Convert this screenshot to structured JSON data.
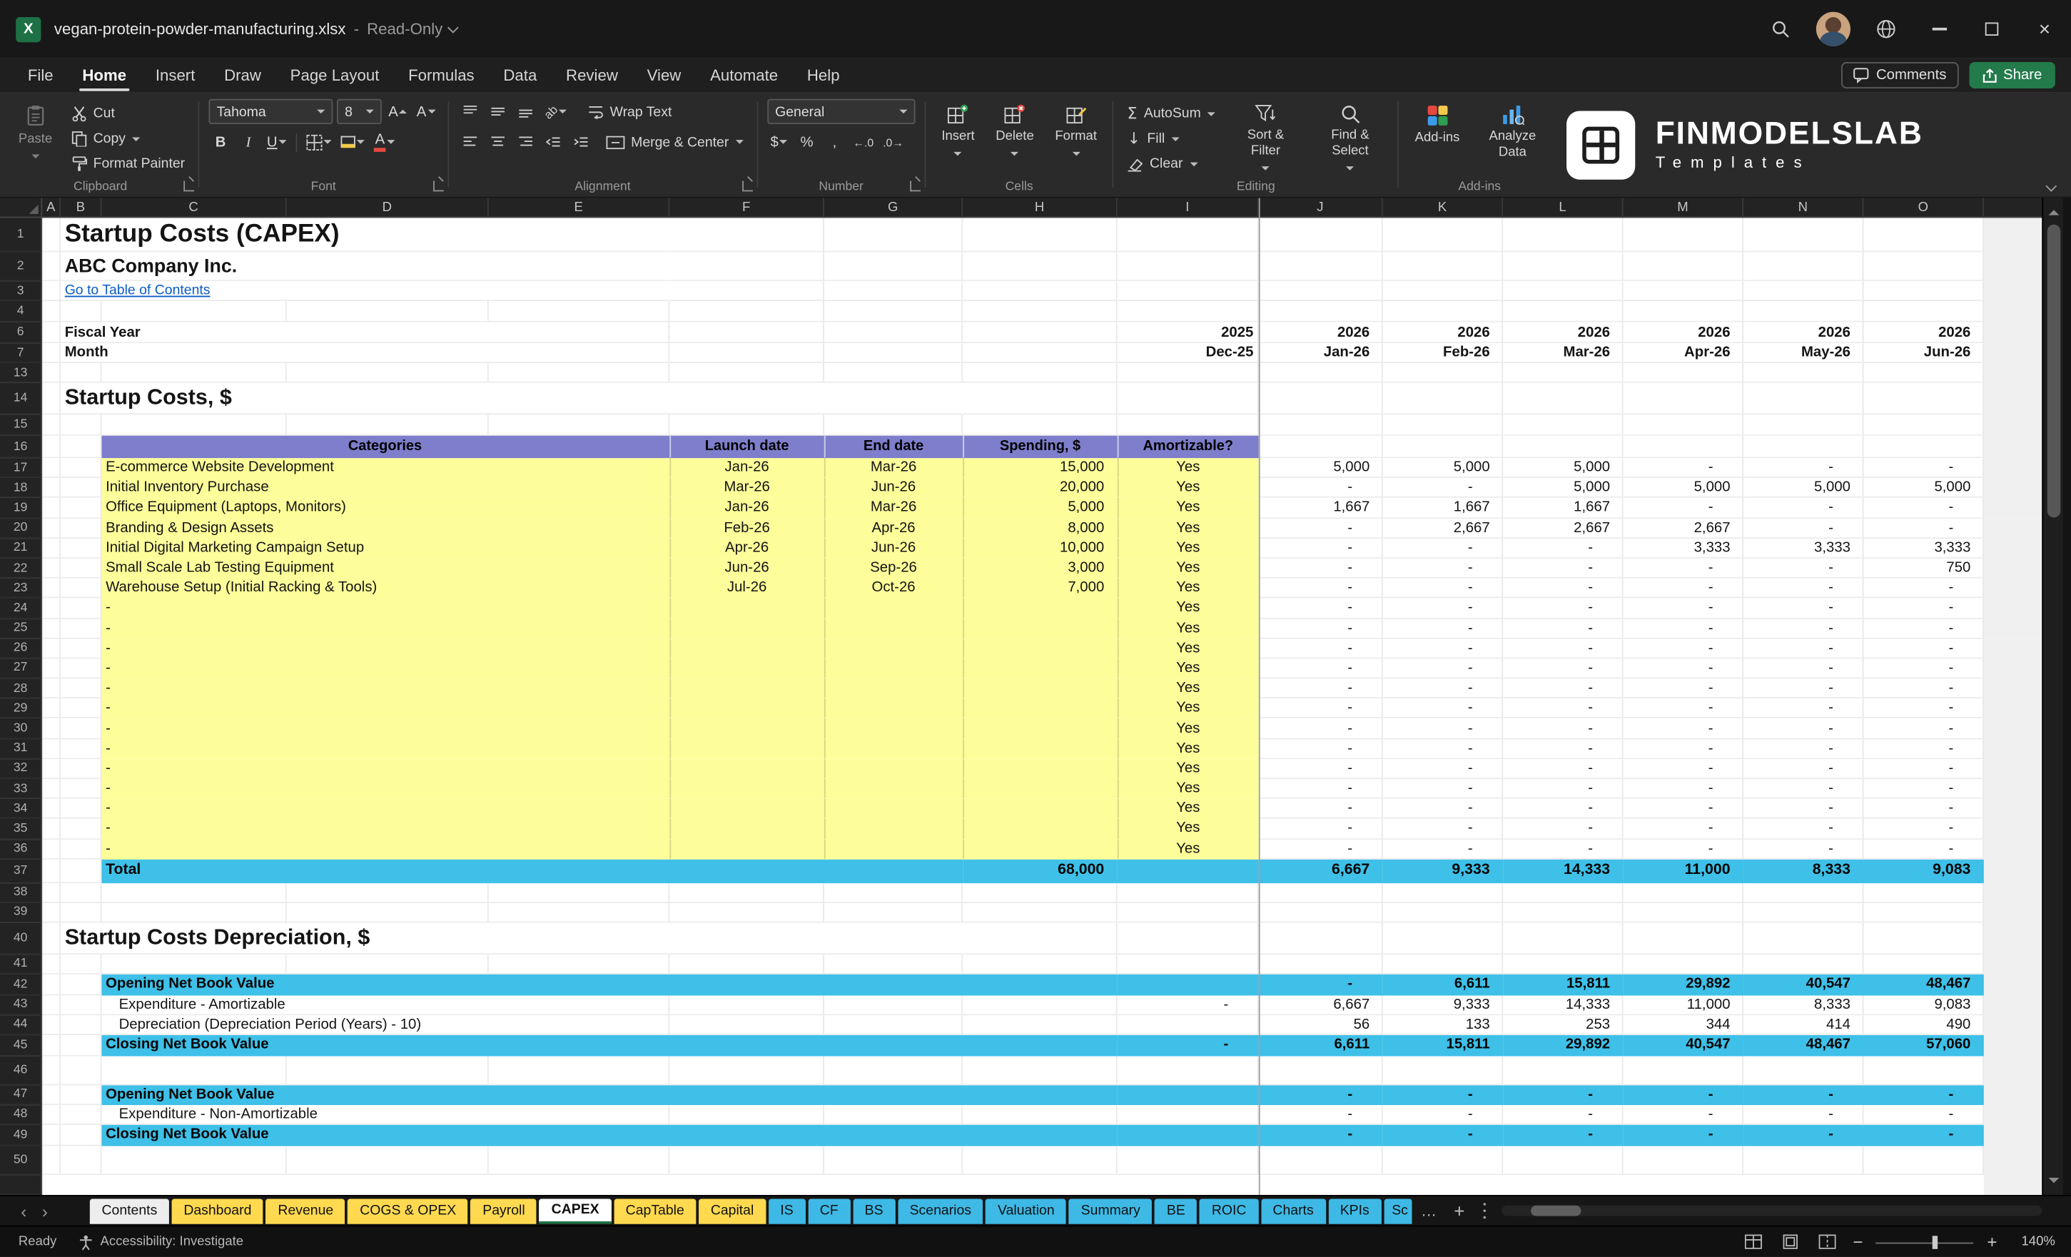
{
  "window": {
    "title": "vegan-protein-powder-manufacturing.xlsx",
    "separator": "-",
    "mode": "Read-Only"
  },
  "menu": {
    "items": [
      "File",
      "Home",
      "Insert",
      "Draw",
      "Page Layout",
      "Formulas",
      "Data",
      "Review",
      "View",
      "Automate",
      "Help"
    ],
    "active": "Home",
    "comments_label": "Comments",
    "share_label": "Share"
  },
  "ribbon": {
    "paste": "Paste",
    "cut": "Cut",
    "copy": "Copy",
    "format_painter": "Format Painter",
    "font_name": "Tahoma",
    "font_size": "8",
    "wrap_text": "Wrap Text",
    "merge_center": "Merge & Center",
    "number_format": "General",
    "insert": "Insert",
    "delete": "Delete",
    "format": "Format",
    "autosum": "AutoSum",
    "fill": "Fill",
    "clear": "Clear",
    "sort_filter": "Sort & Filter",
    "find_select": "Find & Select",
    "addins": "Add-ins",
    "analyze_data": "Analyze Data",
    "groups": {
      "clipboard": "Clipboard",
      "font": "Font",
      "alignment": "Alignment",
      "number": "Number",
      "cells": "Cells",
      "editing": "Editing",
      "addins": "Add-ins"
    }
  },
  "brand": {
    "name": "FINMODELSLAB",
    "subtitle": "Templates"
  },
  "grid_columns": [
    "A",
    "B",
    "C",
    "D",
    "E",
    "F",
    "G",
    "H",
    "I",
    "J",
    "K",
    "L",
    "M",
    "N",
    "O"
  ],
  "sheet": {
    "title": "Startup Costs (CAPEX)",
    "company": "ABC Company Inc.",
    "toc_link": "Go to Table of Contents",
    "row_numbers": [
      1,
      2,
      3,
      4,
      6,
      7,
      13,
      14,
      15,
      16,
      17,
      18,
      19,
      20,
      21,
      22,
      23,
      24,
      25,
      26,
      27,
      28,
      29,
      30,
      31,
      32,
      33,
      34,
      35,
      36,
      37,
      38,
      39,
      40,
      41,
      42,
      43,
      44,
      45,
      46,
      47,
      48,
      49,
      50
    ],
    "fiscal": {
      "label": "Fiscal Year",
      "first": "2025",
      "values": [
        "2026",
        "2026",
        "2026",
        "2026",
        "2026",
        "2026"
      ]
    },
    "month": {
      "label": "Month",
      "first": "Dec-25",
      "values": [
        "Jan-26",
        "Feb-26",
        "Mar-26",
        "Apr-26",
        "May-26",
        "Jun-26"
      ]
    },
    "section1": "Startup Costs, $",
    "table": {
      "headers": {
        "categories": "Categories",
        "launch": "Launch date",
        "end": "End date",
        "spending": "Spending, $",
        "amortizable": "Amortizable?"
      },
      "rows": [
        {
          "category": "E-commerce Website Development",
          "launch": "Jan-26",
          "end": "Mar-26",
          "spending": "15,000",
          "amortizable": "Yes",
          "values": [
            "5,000",
            "5,000",
            "5,000",
            "-",
            "-",
            "-"
          ]
        },
        {
          "category": "Initial Inventory Purchase",
          "launch": "Mar-26",
          "end": "Jun-26",
          "spending": "20,000",
          "amortizable": "Yes",
          "values": [
            "-",
            "-",
            "5,000",
            "5,000",
            "5,000",
            "5,000"
          ]
        },
        {
          "category": "Office Equipment (Laptops, Monitors)",
          "launch": "Jan-26",
          "end": "Mar-26",
          "spending": "5,000",
          "amortizable": "Yes",
          "values": [
            "1,667",
            "1,667",
            "1,667",
            "-",
            "-",
            "-"
          ]
        },
        {
          "category": "Branding & Design Assets",
          "launch": "Feb-26",
          "end": "Apr-26",
          "spending": "8,000",
          "amortizable": "Yes",
          "values": [
            "-",
            "2,667",
            "2,667",
            "2,667",
            "-",
            "-"
          ]
        },
        {
          "category": "Initial Digital Marketing Campaign Setup",
          "launch": "Apr-26",
          "end": "Jun-26",
          "spending": "10,000",
          "amortizable": "Yes",
          "values": [
            "-",
            "-",
            "-",
            "3,333",
            "3,333",
            "3,333"
          ]
        },
        {
          "category": "Small Scale Lab Testing Equipment",
          "launch": "Jun-26",
          "end": "Sep-26",
          "spending": "3,000",
          "amortizable": "Yes",
          "values": [
            "-",
            "-",
            "-",
            "-",
            "-",
            "750"
          ]
        },
        {
          "category": "Warehouse Setup (Initial Racking & Tools)",
          "launch": "Jul-26",
          "end": "Oct-26",
          "spending": "7,000",
          "amortizable": "Yes",
          "values": [
            "-",
            "-",
            "-",
            "-",
            "-",
            "-"
          ]
        },
        {
          "category": "-",
          "launch": "",
          "end": "",
          "spending": "",
          "amortizable": "Yes",
          "values": [
            "-",
            "-",
            "-",
            "-",
            "-",
            "-"
          ]
        },
        {
          "category": "-",
          "launch": "",
          "end": "",
          "spending": "",
          "amortizable": "Yes",
          "values": [
            "-",
            "-",
            "-",
            "-",
            "-",
            "-"
          ]
        },
        {
          "category": "-",
          "launch": "",
          "end": "",
          "spending": "",
          "amortizable": "Yes",
          "values": [
            "-",
            "-",
            "-",
            "-",
            "-",
            "-"
          ]
        },
        {
          "category": "-",
          "launch": "",
          "end": "",
          "spending": "",
          "amortizable": "Yes",
          "values": [
            "-",
            "-",
            "-",
            "-",
            "-",
            "-"
          ]
        },
        {
          "category": "-",
          "launch": "",
          "end": "",
          "spending": "",
          "amortizable": "Yes",
          "values": [
            "-",
            "-",
            "-",
            "-",
            "-",
            "-"
          ]
        },
        {
          "category": "-",
          "launch": "",
          "end": "",
          "spending": "",
          "amortizable": "Yes",
          "values": [
            "-",
            "-",
            "-",
            "-",
            "-",
            "-"
          ]
        },
        {
          "category": "-",
          "launch": "",
          "end": "",
          "spending": "",
          "amortizable": "Yes",
          "values": [
            "-",
            "-",
            "-",
            "-",
            "-",
            "-"
          ]
        },
        {
          "category": "-",
          "launch": "",
          "end": "",
          "spending": "",
          "amortizable": "Yes",
          "values": [
            "-",
            "-",
            "-",
            "-",
            "-",
            "-"
          ]
        },
        {
          "category": "-",
          "launch": "",
          "end": "",
          "spending": "",
          "amortizable": "Yes",
          "values": [
            "-",
            "-",
            "-",
            "-",
            "-",
            "-"
          ]
        },
        {
          "category": "-",
          "launch": "",
          "end": "",
          "spending": "",
          "amortizable": "Yes",
          "values": [
            "-",
            "-",
            "-",
            "-",
            "-",
            "-"
          ]
        },
        {
          "category": "-",
          "launch": "",
          "end": "",
          "spending": "",
          "amortizable": "Yes",
          "values": [
            "-",
            "-",
            "-",
            "-",
            "-",
            "-"
          ]
        },
        {
          "category": "-",
          "launch": "",
          "end": "",
          "spending": "",
          "amortizable": "Yes",
          "values": [
            "-",
            "-",
            "-",
            "-",
            "-",
            "-"
          ]
        },
        {
          "category": "-",
          "launch": "",
          "end": "",
          "spending": "",
          "amortizable": "Yes",
          "values": [
            "-",
            "-",
            "-",
            "-",
            "-",
            "-"
          ]
        }
      ],
      "total_label": "Total",
      "total_spending": "68,000",
      "total_values": [
        "6,667",
        "9,333",
        "14,333",
        "11,000",
        "8,333",
        "9,083"
      ]
    },
    "section2": "Startup Costs Depreciation, $",
    "depreciation_amortizable": [
      {
        "label": "Opening Net Book Value",
        "band": true,
        "first": "",
        "values": [
          "-",
          "6,611",
          "15,811",
          "29,892",
          "40,547",
          "48,467"
        ]
      },
      {
        "label": "Expenditure - Amortizable",
        "band": false,
        "first": "-",
        "values": [
          "6,667",
          "9,333",
          "14,333",
          "11,000",
          "8,333",
          "9,083"
        ]
      },
      {
        "label": "Depreciation (Depreciation Period (Years) - 10)",
        "band": false,
        "first": "",
        "values": [
          "56",
          "133",
          "253",
          "344",
          "414",
          "490"
        ]
      },
      {
        "label": "Closing Net Book Value",
        "band": true,
        "first": "-",
        "values": [
          "6,611",
          "15,811",
          "29,892",
          "40,547",
          "48,467",
          "57,060"
        ]
      }
    ],
    "depreciation_non_amortizable": [
      {
        "label": "Opening Net Book Value",
        "band": true,
        "first": "",
        "values": [
          "-",
          "-",
          "-",
          "-",
          "-",
          "-"
        ]
      },
      {
        "label": "Expenditure - Non-Amortizable",
        "band": false,
        "first": "",
        "values": [
          "-",
          "-",
          "-",
          "-",
          "-",
          "-"
        ]
      },
      {
        "label": "Closing Net Book Value",
        "band": true,
        "first": "",
        "values": [
          "-",
          "-",
          "-",
          "-",
          "-",
          "-"
        ]
      }
    ]
  },
  "tabs": [
    {
      "label": "Contents",
      "color": "white"
    },
    {
      "label": "Dashboard",
      "color": "yellow"
    },
    {
      "label": "Revenue",
      "color": "yellow"
    },
    {
      "label": "COGS & OPEX",
      "color": "yellow"
    },
    {
      "label": "Payroll",
      "color": "yellow"
    },
    {
      "label": "CAPEX",
      "color": "active"
    },
    {
      "label": "CapTable",
      "color": "yellow"
    },
    {
      "label": "Capital",
      "color": "yellow"
    },
    {
      "label": "IS",
      "color": "blue"
    },
    {
      "label": "CF",
      "color": "blue"
    },
    {
      "label": "BS",
      "color": "blue"
    },
    {
      "label": "Scenarios",
      "color": "blue"
    },
    {
      "label": "Valuation",
      "color": "blue"
    },
    {
      "label": "Summary",
      "color": "blue"
    },
    {
      "label": "BE",
      "color": "blue"
    },
    {
      "label": "ROIC",
      "color": "blue"
    },
    {
      "label": "Charts",
      "color": "blue"
    },
    {
      "label": "KPIs",
      "color": "blue"
    },
    {
      "label": "Sc",
      "color": "blue",
      "clipped": true
    }
  ],
  "statusbar": {
    "ready": "Ready",
    "accessibility": "Accessibility: Investigate",
    "zoom": "140%"
  }
}
